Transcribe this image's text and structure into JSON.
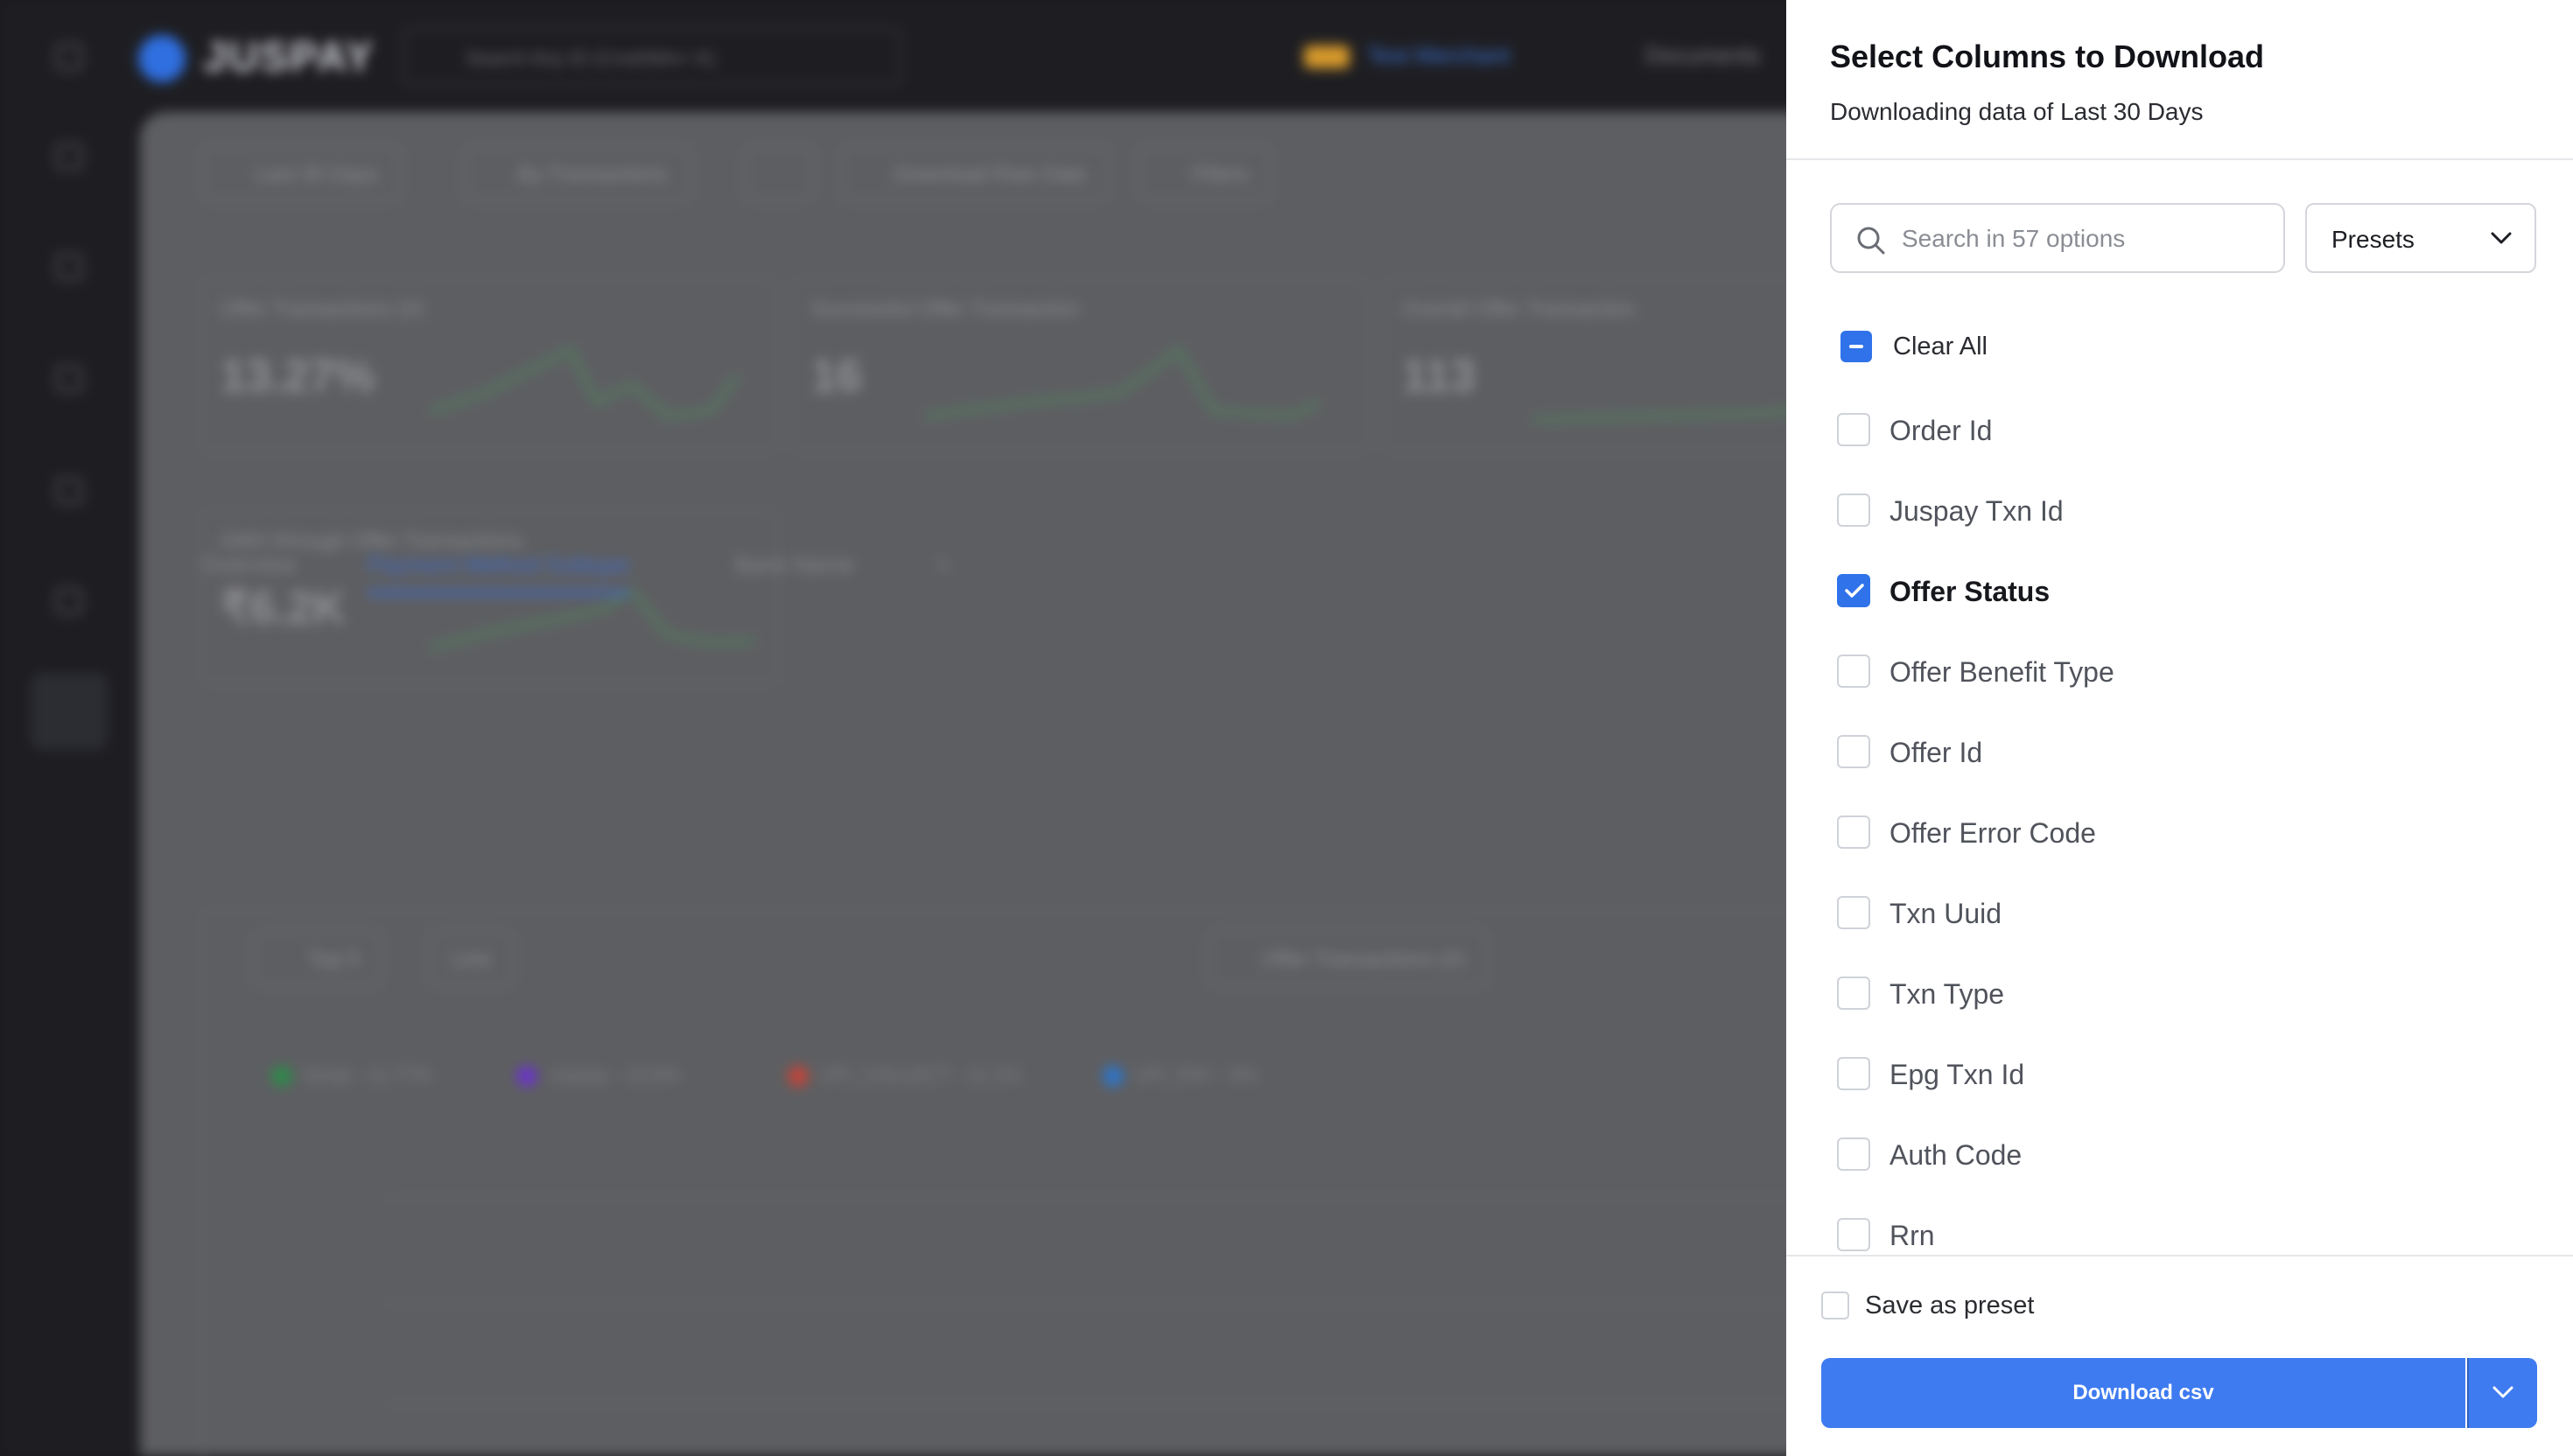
{
  "background": {
    "logo_text": "JUSPAY",
    "search_placeholder": "Search Any ID (Cmd/Win+ K)",
    "merchant_name": "Test Merchant",
    "top_right": "Documents",
    "filters": [
      "Last 30 Days",
      "By Transactions",
      "",
      "Download Raw Data",
      "Filters"
    ],
    "kpis": [
      {
        "label": "Offer Transactions (#)",
        "value": "13.27%"
      },
      {
        "label": "Successful Offer Transaction",
        "value": "16"
      },
      {
        "label": "Overall Offer Transaction",
        "value": "113"
      },
      {
        "label": "GMV through Offer Transactions",
        "value": "₹6.2K"
      }
    ],
    "tabs": [
      "Overview",
      "Payment Method Subtype",
      "Bank Name",
      "+"
    ],
    "chart_controls": [
      "Top 5",
      "Line",
      "Offer Transactions (#)"
    ],
    "legend": [
      {
        "label": "Simpl - 11.77%",
        "color": "#2e8a4a"
      },
      {
        "label": "Juspay - 10.8%",
        "color": "#6a35c9"
      },
      {
        "label": "UPI_COLLECT - 11.1%",
        "color": "#c2453a"
      },
      {
        "label": "UPI_PAY - 9%",
        "color": "#2e75c9"
      }
    ]
  },
  "panel": {
    "title": "Select Columns to Download",
    "subtitle": "Downloading data of Last 30 Days",
    "search_placeholder": "Search in 57 options",
    "presets_label": "Presets",
    "clear_all_label": "Clear All",
    "options": [
      {
        "label": "Order Id",
        "checked": false
      },
      {
        "label": "Juspay Txn Id",
        "checked": false
      },
      {
        "label": "Offer Status",
        "checked": true
      },
      {
        "label": "Offer Benefit Type",
        "checked": false
      },
      {
        "label": "Offer Id",
        "checked": false
      },
      {
        "label": "Offer Error Code",
        "checked": false
      },
      {
        "label": "Txn Uuid",
        "checked": false
      },
      {
        "label": "Txn Type",
        "checked": false
      },
      {
        "label": "Epg Txn Id",
        "checked": false
      },
      {
        "label": "Auth Code",
        "checked": false
      },
      {
        "label": "Rrn",
        "checked": false
      }
    ],
    "save_preset_label": "Save as preset",
    "download_label": "Download csv",
    "accent_color": "#3e7bf0"
  }
}
